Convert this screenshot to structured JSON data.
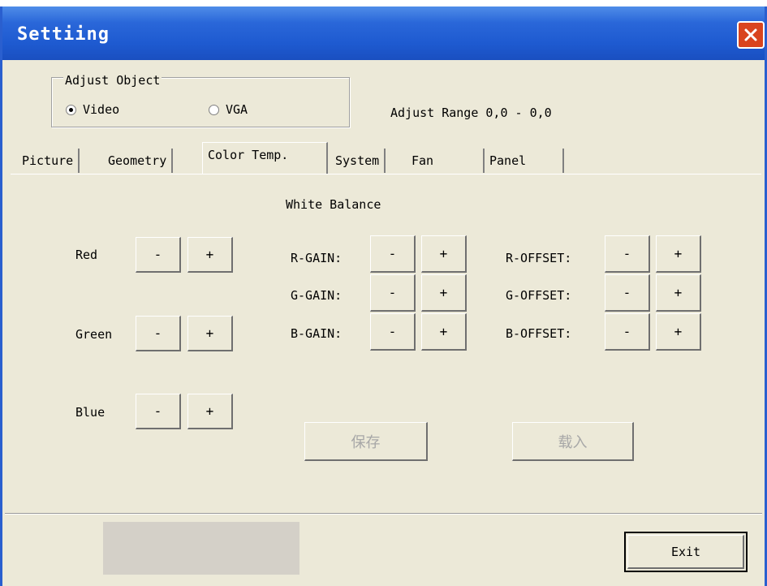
{
  "window": {
    "title": "Settiing"
  },
  "adjust_object": {
    "legend": "Adjust Object",
    "options": [
      {
        "label": "Video",
        "selected": true
      },
      {
        "label": "VGA",
        "selected": false
      }
    ]
  },
  "adjust_range": "Adjust Range 0,0 - 0,0",
  "tabs": [
    {
      "label": "Picture"
    },
    {
      "label": "Geometry"
    },
    {
      "label": "Color Temp.",
      "active": true
    },
    {
      "label": "System"
    },
    {
      "label": "Fan"
    },
    {
      "label": "Panel"
    }
  ],
  "white_balance": {
    "heading": "White Balance",
    "colors": [
      {
        "label": "Red"
      },
      {
        "label": "Green"
      },
      {
        "label": "Blue"
      }
    ],
    "gains": [
      {
        "label": "R-GAIN:"
      },
      {
        "label": "G-GAIN:"
      },
      {
        "label": "B-GAIN:"
      }
    ],
    "offsets": [
      {
        "label": "R-OFFSET:"
      },
      {
        "label": "G-OFFSET:"
      },
      {
        "label": "B-OFFSET:"
      }
    ],
    "minus": "-",
    "plus": "+",
    "save_label": "保存",
    "load_label": "载入"
  },
  "footer": {
    "exit_label": "Exit"
  },
  "colors": {
    "titlebar": "#2a67d9",
    "window_bg": "#ece9d8",
    "close": "#d9441e"
  }
}
